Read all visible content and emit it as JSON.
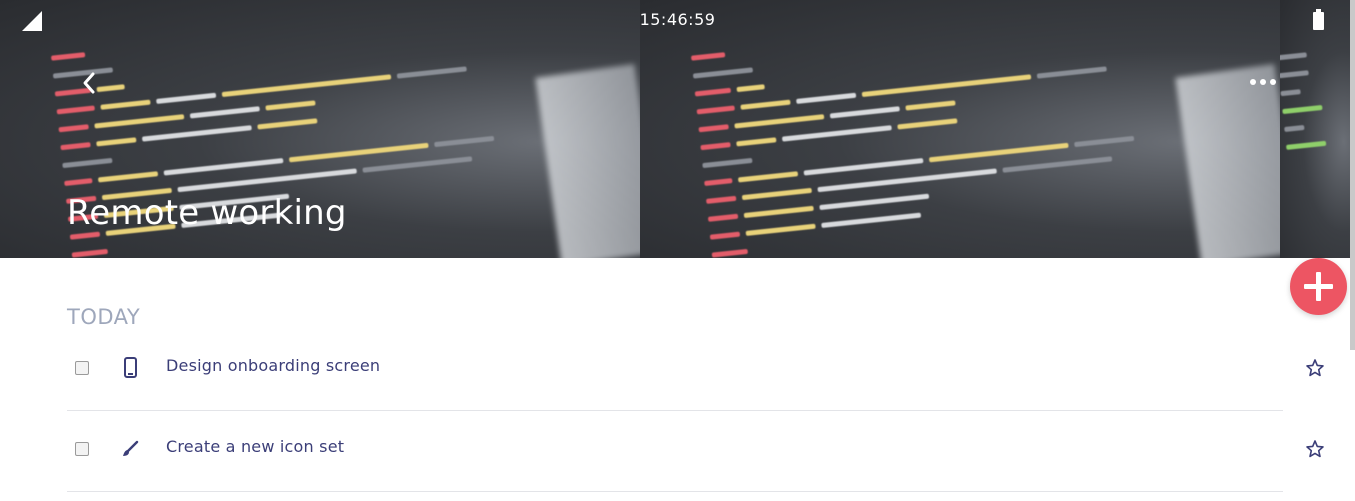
{
  "status_bar": {
    "time": "15:46:59",
    "signal_icon": "signal-icon",
    "battery_icon": "battery-icon"
  },
  "header": {
    "title": "Remote working",
    "back_icon": "chevron-left-icon",
    "more_icon": "more-horizontal-icon"
  },
  "fab": {
    "icon": "plus-icon",
    "color": "#ed5563"
  },
  "section": {
    "label": "TODAY"
  },
  "tasks": [
    {
      "label": "Design onboarding screen",
      "icon": "mobile-phone-icon",
      "checked": false,
      "starred": false
    },
    {
      "label": "Create a new icon set",
      "icon": "brush-icon",
      "checked": false,
      "starred": false
    }
  ],
  "colors": {
    "accent": "#ed5563",
    "task_text": "#3b3e78",
    "section_text": "#9ea7bb"
  }
}
